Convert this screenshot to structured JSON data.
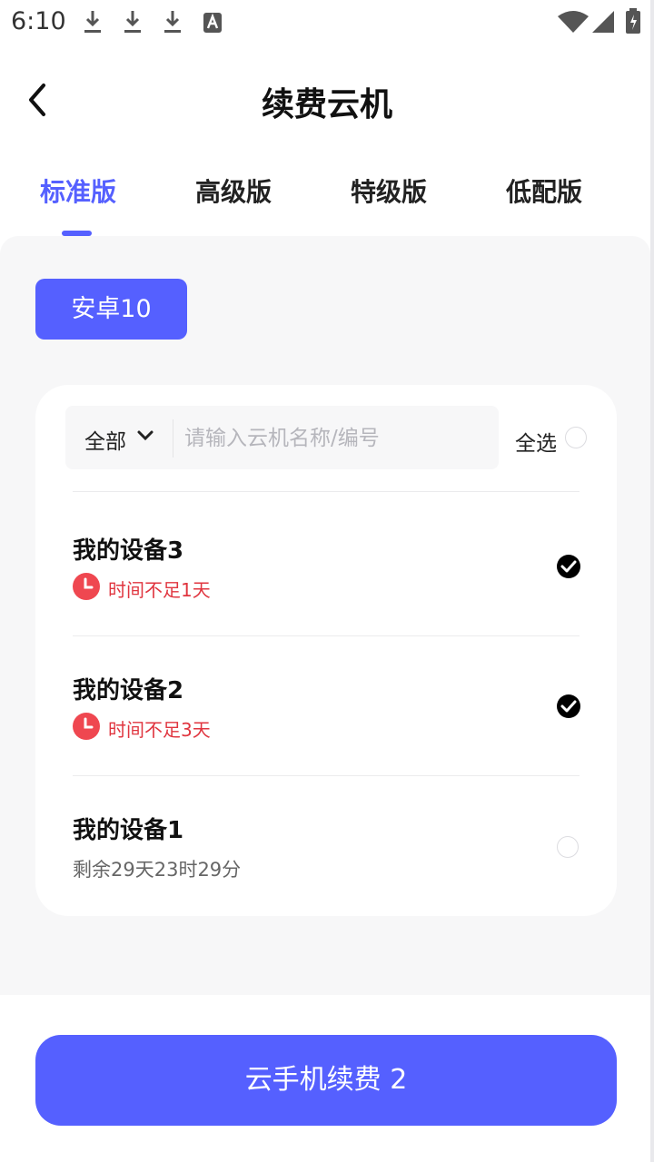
{
  "status_bar": {
    "time": "6:10",
    "icons": [
      "download-icon",
      "download-icon",
      "download-icon",
      "font-icon",
      "wifi-icon",
      "signal-icon",
      "battery-icon"
    ]
  },
  "header": {
    "title": "续费云机",
    "back_icon": "back-chevron-icon"
  },
  "tabs": [
    {
      "label": "标准版",
      "active": true
    },
    {
      "label": "高级版",
      "active": false
    },
    {
      "label": "特级版",
      "active": false
    },
    {
      "label": "低配版",
      "active": false
    }
  ],
  "version": {
    "label": "安卓10"
  },
  "filter": {
    "category": "全部",
    "search_placeholder": "请输入云机名称/编号",
    "select_all": "全选"
  },
  "devices": [
    {
      "name": "我的设备3",
      "status": "时间不足1天",
      "warning": true,
      "checked": true
    },
    {
      "name": "我的设备2",
      "status": "时间不足3天",
      "warning": true,
      "checked": true
    },
    {
      "name": "我的设备1",
      "status": "剩余29天23时29分",
      "warning": false,
      "checked": false
    }
  ],
  "footer": {
    "button_label": "云手机续费 2"
  },
  "colors": {
    "accent": "#5560ff",
    "warning": "#e0353f",
    "panel_bg": "#f7f7f8"
  }
}
